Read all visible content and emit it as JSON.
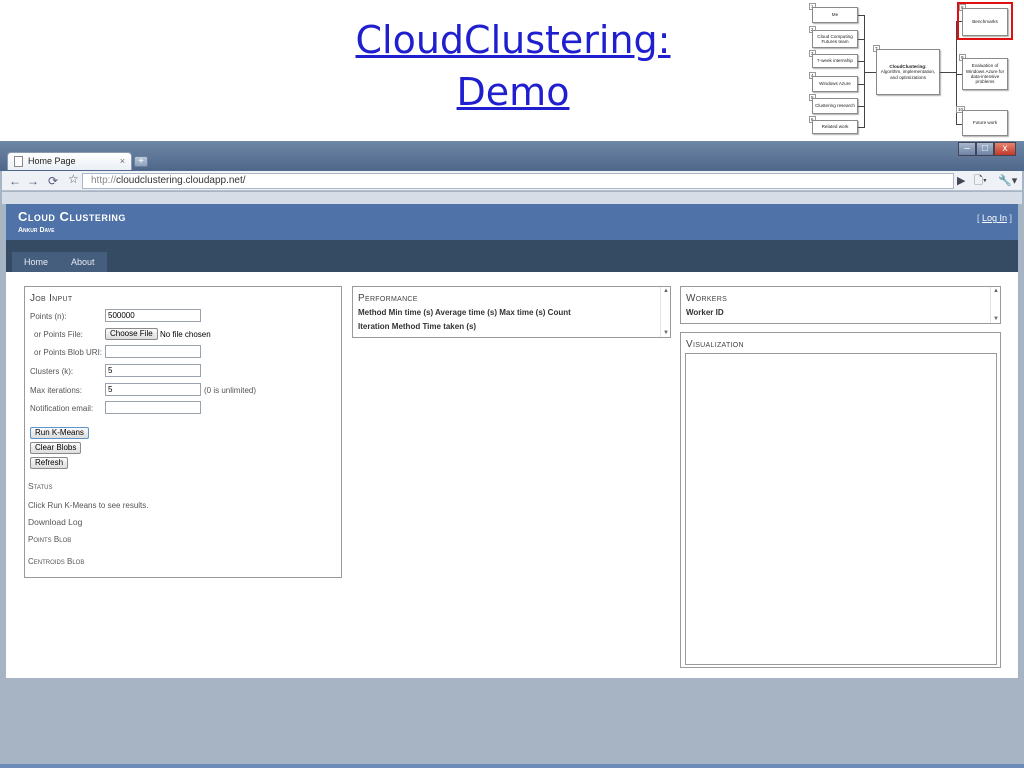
{
  "slide": {
    "title_line1": "CloudClustering:",
    "title_line2": "Demo"
  },
  "diagram": {
    "left_boxes": [
      {
        "num": "1",
        "label": "Me"
      },
      {
        "num": "2",
        "label": "Cloud Computing Futures team"
      },
      {
        "num": "3",
        "label": "7-week internship"
      },
      {
        "num": "4",
        "label": "Windows Azure"
      },
      {
        "num": "5",
        "label": "Clustering research"
      },
      {
        "num": "6",
        "label": "Related work"
      }
    ],
    "center_box": {
      "num": "7",
      "title": "CloudClustering:",
      "label": "Algorithm, implementation, and optimizations"
    },
    "right_boxes": [
      {
        "num": "8",
        "label": "Benchmarks"
      },
      {
        "num": "9",
        "label": "Evaluation of Windows Azure for data-intensive problems"
      },
      {
        "num": "10",
        "label": "Future work"
      }
    ]
  },
  "browser": {
    "tab_title": "Home Page",
    "tab_close": "×",
    "new_tab": "+",
    "url_proto": "http://",
    "url_rest": "cloudclustering.cloudapp.net/",
    "win_min": "–",
    "win_max": "□",
    "win_close": "x"
  },
  "site": {
    "title": "Cloud Clustering",
    "subtitle": "Ankur Dave",
    "login_open": "[ ",
    "login_label": "Log In",
    "login_close": " ]",
    "nav": [
      "Home",
      "About"
    ]
  },
  "job_input": {
    "title": "Job Input",
    "points_label": "Points (n):",
    "points_value": "500000",
    "file_label": "or Points File:",
    "choose_file": "Choose File",
    "no_file": "No file chosen",
    "blob_label": "or Points Blob URI:",
    "blob_value": "",
    "clusters_label": "Clusters (k):",
    "clusters_value": "5",
    "maxiter_label": "Max iterations:",
    "maxiter_value": "5",
    "maxiter_hint": "(0 is unlimited)",
    "email_label": "Notification email:",
    "email_value": "",
    "run_button": "Run K-Means",
    "clear_button": "Clear Blobs",
    "refresh_button": "Refresh",
    "status_title": "Status",
    "status_text": "Click Run K-Means to see results.",
    "download_log": "Download Log",
    "points_blob": "Points Blob",
    "centroids_blob": "Centroids Blob"
  },
  "performance": {
    "title": "Performance",
    "header1": "Method Min time (s) Average time (s) Max time (s) Count",
    "header2": "Iteration Method Time taken (s)"
  },
  "workers": {
    "title": "Workers",
    "header": "Worker ID"
  },
  "visualization": {
    "title": "Visualization"
  }
}
